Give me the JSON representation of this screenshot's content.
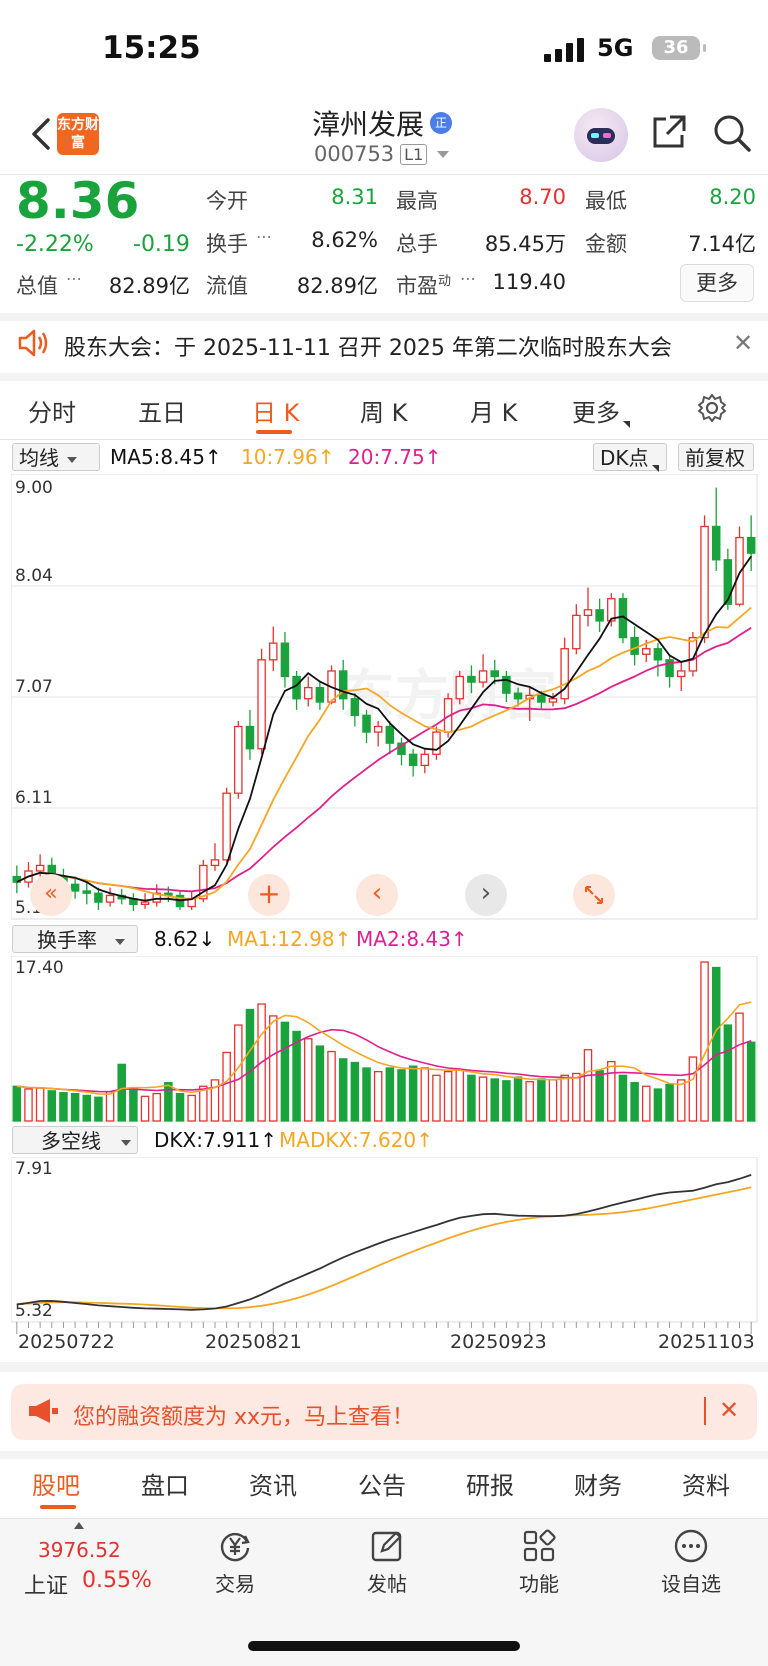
{
  "status": {
    "time": "15:25",
    "network": "5G",
    "battery": "36"
  },
  "header": {
    "logo_text": "东方财富",
    "stock_name": "漳州发展",
    "badge": "正",
    "stock_code": "000753",
    "level": "L1"
  },
  "quote": {
    "price": "8.36",
    "change_pct": "-2.22%",
    "change": "-0.19",
    "open_label": "今开",
    "open": "8.31",
    "high_label": "最高",
    "high": "8.70",
    "low_label": "最低",
    "low": "8.20",
    "turnover_label": "换手",
    "turnover": "8.62%",
    "volume_label": "总手",
    "volume": "85.45万",
    "amount_label": "金额",
    "amount": "7.14亿",
    "mktcap_label": "总值",
    "mktcap": "82.89亿",
    "float_label": "流值",
    "float": "82.89亿",
    "pe_label": "市盈",
    "pe_sup": "动",
    "pe": "119.40",
    "more_label": "更多"
  },
  "notice": {
    "text": "股东大会：于 2025-11-11 召开 2025 年第二次临时股东大会"
  },
  "ktabs": [
    "分时",
    "五日",
    "日 K",
    "周 K",
    "月 K",
    "更多"
  ],
  "main_chart": {
    "indicator_select": "均线",
    "ma5": "MA5:8.45↑",
    "ma10": "10:7.96↑",
    "ma20": "20:7.75↑",
    "dk_label": "DK点",
    "fq_label": "前复权",
    "y_labels": [
      "9.00",
      "8.04",
      "7.07",
      "6.11",
      "5.14"
    ],
    "colors": {
      "up": "#e8312f",
      "down": "#1aa33c",
      "ma5": "#111111",
      "ma10": "#f5a623",
      "ma20": "#e0208f"
    }
  },
  "volume_chart": {
    "indicator_select": "换手率",
    "value": "8.62↓",
    "ma1": "MA1:12.98↑",
    "ma2": "MA2:8.43↑",
    "y_label": "17.40"
  },
  "dkx_chart": {
    "indicator_select": "多空线",
    "dkx": "DKX:7.911↑",
    "madkx": "MADKX:7.620↑",
    "y_top": "7.91",
    "y_bottom": "5.32"
  },
  "x_labels": [
    "20250722",
    "20250821",
    "20250923",
    "20251103"
  ],
  "ad": {
    "text": "您的融资额度为 xx元，马上查看！"
  },
  "bottom_tabs": [
    "股吧",
    "盘口",
    "资讯",
    "公告",
    "研报",
    "财务",
    "资料"
  ],
  "tabbar": {
    "index_value": "3976.52",
    "index_name": "上证",
    "index_pct": "0.55%",
    "items": [
      "交易",
      "发帖",
      "功能",
      "设自选"
    ]
  },
  "chart_data": {
    "type": "candlestick",
    "ylim": [
      5.14,
      9.0
    ],
    "candles": [
      [
        5.45,
        5.4,
        5.55,
        5.3
      ],
      [
        5.4,
        5.5,
        5.58,
        5.35
      ],
      [
        5.5,
        5.55,
        5.65,
        5.45
      ],
      [
        5.55,
        5.45,
        5.62,
        5.38
      ],
      [
        5.45,
        5.38,
        5.52,
        5.3
      ],
      [
        5.38,
        5.32,
        5.45,
        5.25
      ],
      [
        5.32,
        5.3,
        5.4,
        5.2
      ],
      [
        5.3,
        5.22,
        5.35,
        5.15
      ],
      [
        5.22,
        5.28,
        5.35,
        5.18
      ],
      [
        5.28,
        5.25,
        5.34,
        5.2
      ],
      [
        5.25,
        5.2,
        5.3,
        5.14
      ],
      [
        5.2,
        5.22,
        5.3,
        5.16
      ],
      [
        5.22,
        5.3,
        5.38,
        5.18
      ],
      [
        5.3,
        5.28,
        5.36,
        5.22
      ],
      [
        5.28,
        5.18,
        5.32,
        5.15
      ],
      [
        5.18,
        5.25,
        5.32,
        5.15
      ],
      [
        5.25,
        5.55,
        5.6,
        5.22
      ],
      [
        5.55,
        5.6,
        5.75,
        5.5
      ],
      [
        5.6,
        6.2,
        6.25,
        5.58
      ],
      [
        6.2,
        6.8,
        6.85,
        6.15
      ],
      [
        6.8,
        6.6,
        6.95,
        6.5
      ],
      [
        6.6,
        7.4,
        7.5,
        6.55
      ],
      [
        7.4,
        7.55,
        7.7,
        7.3
      ],
      [
        7.55,
        7.25,
        7.65,
        7.15
      ],
      [
        7.25,
        7.05,
        7.3,
        6.95
      ],
      [
        7.05,
        7.15,
        7.25,
        6.98
      ],
      [
        7.15,
        7.02,
        7.2,
        6.95
      ],
      [
        7.02,
        7.3,
        7.35,
        7.0
      ],
      [
        7.3,
        7.05,
        7.4,
        6.95
      ],
      [
        7.05,
        6.9,
        7.1,
        6.8
      ],
      [
        6.9,
        6.75,
        6.95,
        6.65
      ],
      [
        6.75,
        6.8,
        6.85,
        6.62
      ],
      [
        6.8,
        6.65,
        6.85,
        6.55
      ],
      [
        6.65,
        6.55,
        6.7,
        6.45
      ],
      [
        6.55,
        6.45,
        6.6,
        6.35
      ],
      [
        6.45,
        6.55,
        6.6,
        6.38
      ],
      [
        6.55,
        6.75,
        6.8,
        6.5
      ],
      [
        6.75,
        7.05,
        7.1,
        6.7
      ],
      [
        7.05,
        7.25,
        7.3,
        7.0
      ],
      [
        7.25,
        7.2,
        7.35,
        7.1
      ],
      [
        7.2,
        7.3,
        7.45,
        7.15
      ],
      [
        7.3,
        7.25,
        7.4,
        7.18
      ],
      [
        7.25,
        7.1,
        7.3,
        7.02
      ],
      [
        7.1,
        7.05,
        7.15,
        6.98
      ],
      [
        7.05,
        7.08,
        7.15,
        6.85
      ],
      [
        7.08,
        7.02,
        7.12,
        6.95
      ],
      [
        7.02,
        7.05,
        7.1,
        6.98
      ],
      [
        7.05,
        7.5,
        7.6,
        7.0
      ],
      [
        7.5,
        7.8,
        7.9,
        7.45
      ],
      [
        7.8,
        7.85,
        8.05,
        7.7
      ],
      [
        7.85,
        7.75,
        7.95,
        7.65
      ],
      [
        7.75,
        7.95,
        8.0,
        7.7
      ],
      [
        7.95,
        7.6,
        8.0,
        7.55
      ],
      [
        7.6,
        7.45,
        7.7,
        7.35
      ],
      [
        7.45,
        7.5,
        7.58,
        7.38
      ],
      [
        7.5,
        7.4,
        7.55,
        7.25
      ],
      [
        7.4,
        7.25,
        7.45,
        7.15
      ],
      [
        7.25,
        7.3,
        7.38,
        7.12
      ],
      [
        7.3,
        7.6,
        7.65,
        7.25
      ],
      [
        7.6,
        8.6,
        8.7,
        7.55
      ],
      [
        8.6,
        8.3,
        8.95,
        8.2
      ],
      [
        8.3,
        7.9,
        8.4,
        7.85
      ],
      [
        7.9,
        8.5,
        8.6,
        7.88
      ],
      [
        8.5,
        8.36,
        8.7,
        8.2
      ]
    ],
    "turnover": [
      3.8,
      3.5,
      3.6,
      3.3,
      3.1,
      3.0,
      2.8,
      2.6,
      3.2,
      6.2,
      3.5,
      2.7,
      3.0,
      4.2,
      3.0,
      2.8,
      3.8,
      4.5,
      7.5,
      10.5,
      12.2,
      12.8,
      11.5,
      10.8,
      9.8,
      9.0,
      8.2,
      7.6,
      6.8,
      6.4,
      5.8,
      5.4,
      5.8,
      5.6,
      6.0,
      5.8,
      5.0,
      5.4,
      5.6,
      5.0,
      4.8,
      4.6,
      4.4,
      4.8,
      4.3,
      4.6,
      4.5,
      5.0,
      5.2,
      7.8,
      5.5,
      6.5,
      5.0,
      4.2,
      3.8,
      3.5,
      4.0,
      4.5,
      7.0,
      17.4,
      16.8,
      10.5,
      11.8,
      8.62
    ]
  }
}
